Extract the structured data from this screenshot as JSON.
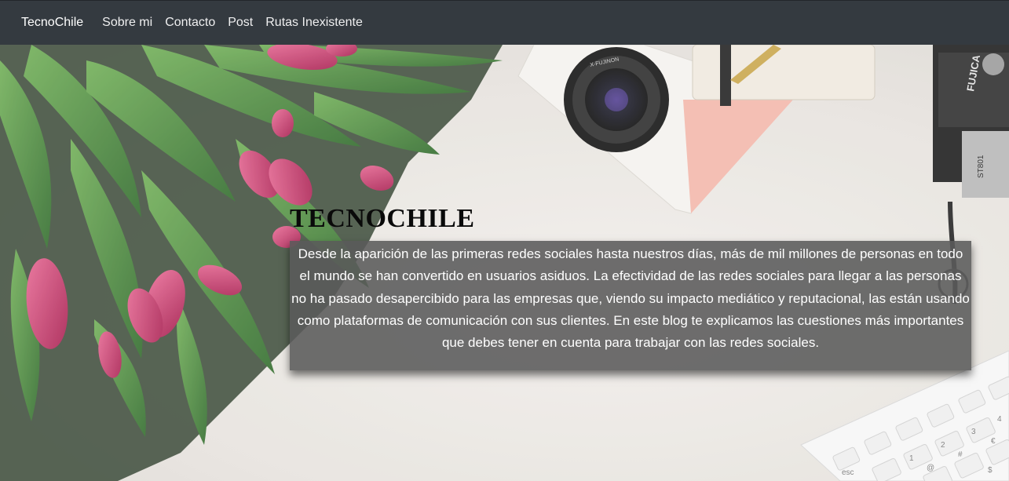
{
  "navbar": {
    "brand": "TecnoChile",
    "links": [
      "Sobre mi",
      "Contacto",
      "Post",
      "Rutas Inexistente"
    ]
  },
  "hero": {
    "title": "TECNOCHILE",
    "description": "Desde la aparición de las primeras redes sociales hasta nuestros días, más de mil millones de personas en todo el mundo se han convertido en usuarios asiduos. La efectividad de las redes sociales para llegar a las personas no ha pasado desapercibido para las empresas que, viendo su impacto mediático y reputacional, las están usando como plataformas de comunicación con sus clientes. En este blog te explicamos las cuestiones más importantes que debes tener en cuenta para trabajar con las redes sociales."
  },
  "background": {
    "camera_lens_brand": "X-FUJINON",
    "camera_brand": "FUJICA",
    "camera_model": "ST801",
    "keyboard_keys": [
      "1",
      "2",
      "3",
      "4",
      "@",
      "#",
      "$",
      "€",
      "esc"
    ]
  },
  "colors": {
    "navbar_bg": "#343a40",
    "overlay_bg": "#5a5a5a",
    "tulip_pink": "#d23a6e",
    "leaf_green": "#4e8a3c"
  }
}
